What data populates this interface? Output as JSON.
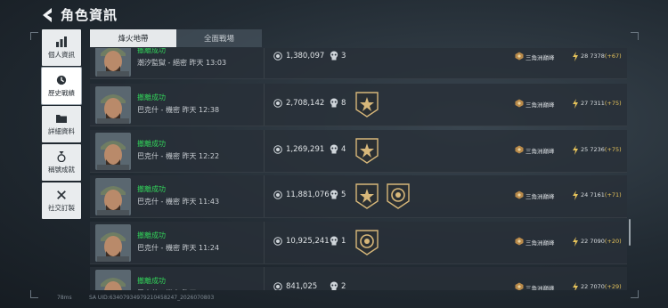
{
  "header": {
    "title": "角色資訊"
  },
  "sidebar": {
    "items": [
      {
        "label": "個人資訊",
        "icon": "bar-chart-icon"
      },
      {
        "label": "歷史戰績",
        "icon": "history-clock-icon"
      },
      {
        "label": "詳細資料",
        "icon": "folder-icon"
      },
      {
        "label": "稱號成就",
        "icon": "medal-icon"
      },
      {
        "label": "社交訂製",
        "icon": "tools-icon"
      }
    ]
  },
  "tabs": [
    {
      "label": "烽火地帶",
      "active": true
    },
    {
      "label": "全面戰場",
      "active": false
    }
  ],
  "matches": [
    {
      "status": "撤離成功",
      "detail": "潮汐監獄 - 絕密 昨天 13:03",
      "coins": "1,380,097",
      "kills": "3",
      "badges": [],
      "rank_name": "三角洲巔峰",
      "rank_level": "28",
      "rank_score": "7378",
      "rank_delta": "(+67)"
    },
    {
      "status": "撤離成功",
      "detail": "巴克什 - 機密 昨天 12:38",
      "coins": "2,708,142",
      "kills": "8",
      "badges": [
        "star-badge"
      ],
      "rank_name": "三角洲巔峰",
      "rank_level": "27",
      "rank_score": "7311",
      "rank_delta": "(+75)"
    },
    {
      "status": "撤離成功",
      "detail": "巴克什 - 機密 昨天 12:22",
      "coins": "1,269,291",
      "kills": "4",
      "badges": [
        "star-badge"
      ],
      "rank_name": "三角洲巔峰",
      "rank_level": "25",
      "rank_score": "7236",
      "rank_delta": "(+75)"
    },
    {
      "status": "撤離成功",
      "detail": "巴克什 - 機密 昨天 11:43",
      "coins": "11,881,076",
      "kills": "5",
      "badges": [
        "star-badge",
        "target-badge"
      ],
      "rank_name": "三角洲巔峰",
      "rank_level": "24",
      "rank_score": "7161",
      "rank_delta": "(+71)"
    },
    {
      "status": "撤離成功",
      "detail": "巴克什 - 機密 昨天 11:24",
      "coins": "10,925,241",
      "kills": "1",
      "badges": [
        "target-badge"
      ],
      "rank_name": "三角洲巔峰",
      "rank_level": "22",
      "rank_score": "7090",
      "rank_delta": "(+20)"
    },
    {
      "status": "撤離成功",
      "detail": "巴克什 - 機密 昨天 08:33",
      "coins": "841,025",
      "kills": "2",
      "badges": [],
      "rank_name": "三角洲巔峰",
      "rank_level": "22",
      "rank_score": "7070",
      "rank_delta": "(+29)"
    }
  ],
  "footer": {
    "ping": "78ms",
    "uid": "SA UID:63407934979210458247_2026070803"
  },
  "colors": {
    "success": "#32d35a",
    "delta": "#e6c35a",
    "badge": "#d7b77a"
  }
}
